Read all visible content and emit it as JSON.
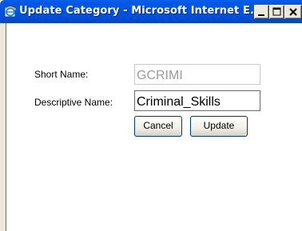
{
  "window": {
    "title": "Update Category - Microsoft Internet E...",
    "icon": "internet-explorer-icon",
    "controls": {
      "minimize": "minimize-icon",
      "maximize": "maximize-icon",
      "close": "close-icon"
    }
  },
  "form": {
    "short_name_label": "Short Name:",
    "short_name_value": "GCRIMI",
    "descriptive_name_label": "Descriptive Name:",
    "descriptive_name_value": "Criminal_Skills",
    "cancel_label": "Cancel",
    "update_label": "Update"
  },
  "colors": {
    "titlebar": "#0054e3",
    "title_text": "#ffffff",
    "disabled_text": "#9b9b9b"
  }
}
